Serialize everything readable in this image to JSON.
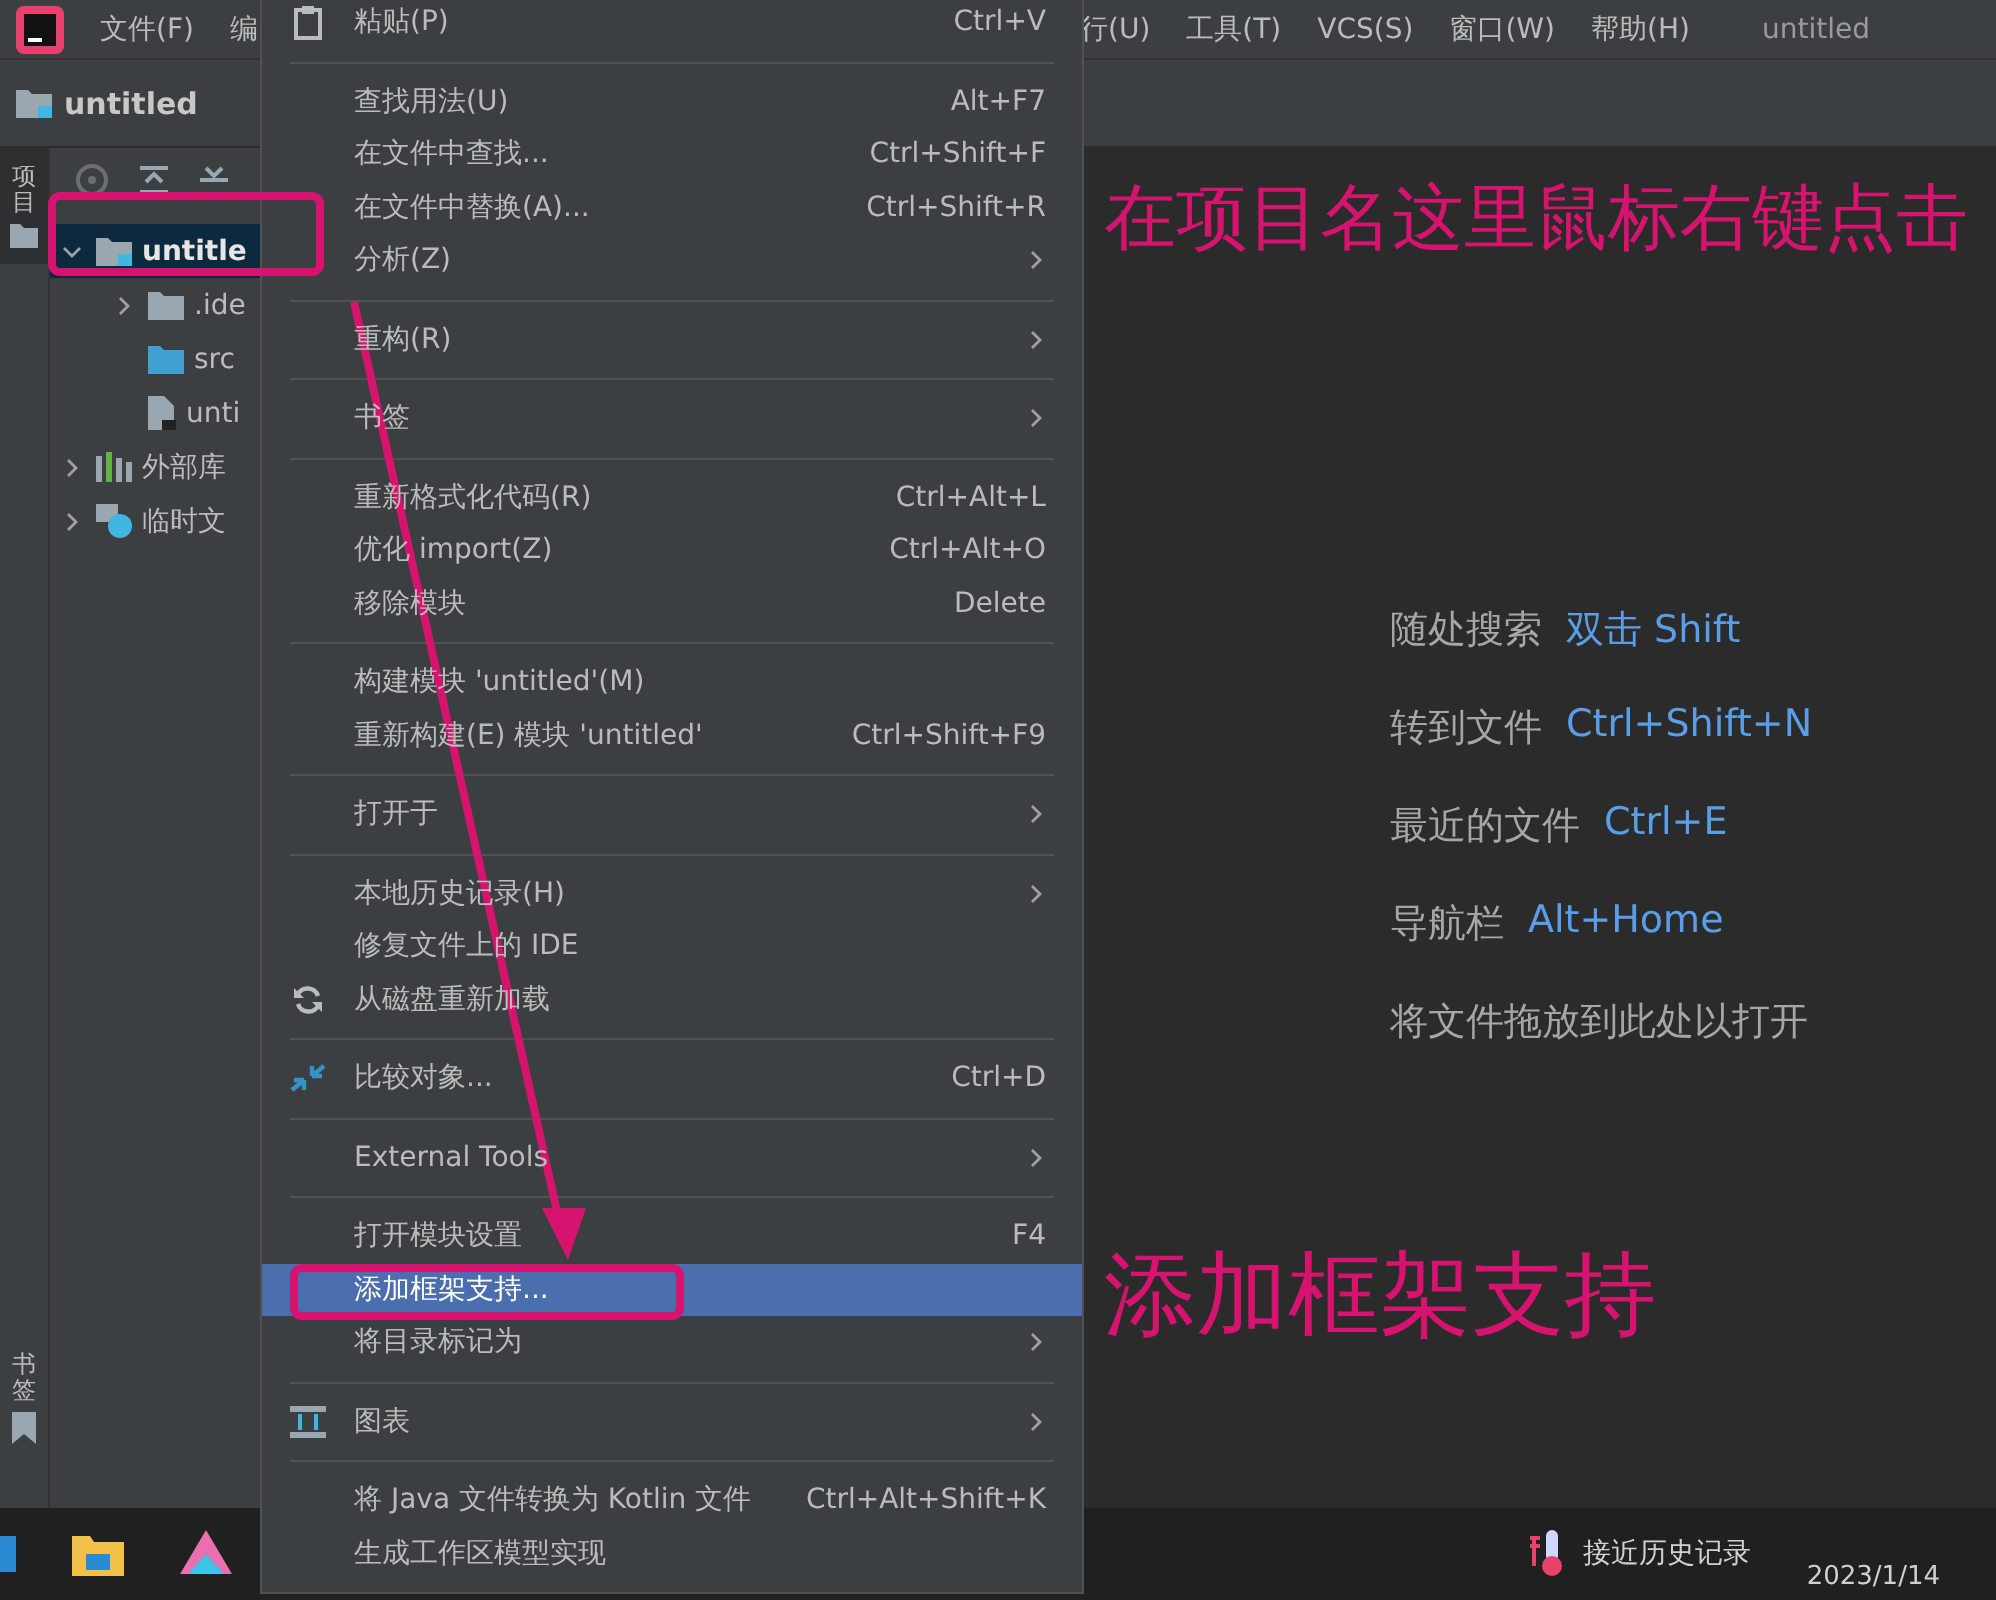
{
  "menu_bar": {
    "items": [
      {
        "label": "文件(F)"
      },
      {
        "label": "编"
      }
    ],
    "right_items": [
      {
        "label": "行(U)"
      },
      {
        "label": "工具(T)"
      },
      {
        "label": "VCS(S)"
      },
      {
        "label": "窗口(W)"
      },
      {
        "label": "帮助(H)"
      }
    ],
    "title": "untitled"
  },
  "nav_bar": {
    "project": "untitled"
  },
  "tool_strip": {
    "top": [
      {
        "label": "项目",
        "selected": true
      }
    ],
    "bottom": [
      {
        "label": "书签",
        "selected": false
      }
    ]
  },
  "project_tree": [
    {
      "label": "untitle",
      "kind": "module",
      "expanded": true,
      "selected": true,
      "children": [
        {
          "label": ".ide",
          "kind": "folder",
          "expanded": false,
          "selected": false
        },
        {
          "label": "src",
          "kind": "source",
          "selected": false
        },
        {
          "label": "unti",
          "kind": "file",
          "selected": false
        }
      ]
    },
    {
      "label": "外部库",
      "kind": "library",
      "expanded": false,
      "selected": false
    },
    {
      "label": "临时文",
      "kind": "scratch",
      "expanded": false,
      "selected": false
    }
  ],
  "context_menu": {
    "groups": [
      [
        {
          "label": "粘贴(P)",
          "shortcut": "Ctrl+V",
          "submenu": false,
          "selected": false,
          "kind": "paste"
        }
      ],
      [
        {
          "label": "查找用法(U)",
          "shortcut": "Alt+F7",
          "submenu": false,
          "selected": false,
          "kind": "plain"
        },
        {
          "label": "在文件中查找...",
          "shortcut": "Ctrl+Shift+F",
          "submenu": false,
          "selected": false,
          "kind": "plain"
        },
        {
          "label": "在文件中替换(A)...",
          "shortcut": "Ctrl+Shift+R",
          "submenu": false,
          "selected": false,
          "kind": "plain"
        },
        {
          "label": "分析(Z)",
          "submenu": true,
          "selected": false,
          "kind": "plain"
        }
      ],
      [
        {
          "label": "重构(R)",
          "submenu": true,
          "selected": false,
          "kind": "plain"
        }
      ],
      [
        {
          "label": "书签",
          "submenu": true,
          "selected": false,
          "kind": "plain"
        }
      ],
      [
        {
          "label": "重新格式化代码(R)",
          "shortcut": "Ctrl+Alt+L",
          "submenu": false,
          "selected": false,
          "kind": "plain"
        },
        {
          "label": "优化 import(Z)",
          "shortcut": "Ctrl+Alt+O",
          "submenu": false,
          "selected": false,
          "kind": "plain"
        },
        {
          "label": "移除模块",
          "shortcut": "Delete",
          "submenu": false,
          "selected": false,
          "kind": "plain"
        }
      ],
      [
        {
          "label": "构建模块 'untitled'(M)",
          "submenu": false,
          "selected": false,
          "kind": "plain"
        },
        {
          "label": "重新构建(E) 模块 'untitled'",
          "shortcut": "Ctrl+Shift+F9",
          "submenu": false,
          "selected": false,
          "kind": "plain"
        }
      ],
      [
        {
          "label": "打开于",
          "submenu": true,
          "selected": false,
          "kind": "plain"
        }
      ],
      [
        {
          "label": "本地历史记录(H)",
          "submenu": true,
          "selected": false,
          "kind": "plain"
        },
        {
          "label": "修复文件上的 IDE",
          "submenu": false,
          "selected": false,
          "kind": "plain"
        },
        {
          "label": "从磁盘重新加载",
          "submenu": false,
          "selected": false,
          "kind": "reload"
        }
      ],
      [
        {
          "label": "比较对象...",
          "shortcut": "Ctrl+D",
          "submenu": false,
          "selected": false,
          "kind": "compare"
        }
      ],
      [
        {
          "label": "External Tools",
          "submenu": true,
          "selected": false,
          "kind": "plain"
        }
      ],
      [
        {
          "label": "打开模块设置",
          "shortcut": "F4",
          "submenu": false,
          "selected": false,
          "kind": "plain"
        },
        {
          "label": "添加框架支持...",
          "submenu": false,
          "selected": true,
          "kind": "plain"
        },
        {
          "label": "将目录标记为",
          "submenu": true,
          "selected": false,
          "kind": "plain"
        }
      ],
      [
        {
          "label": "图表",
          "submenu": true,
          "selected": false,
          "kind": "diagram"
        }
      ],
      [
        {
          "label": "将 Java 文件转换为 Kotlin 文件",
          "shortcut": "Ctrl+Alt+Shift+K",
          "submenu": false,
          "selected": false,
          "kind": "plain"
        },
        {
          "label": "生成工作区模型实现",
          "submenu": false,
          "selected": false,
          "kind": "plain"
        }
      ]
    ]
  },
  "welcome": [
    {
      "label": "随处搜索",
      "shortcut": "双击 Shift"
    },
    {
      "label": "转到文件",
      "shortcut": "Ctrl+Shift+N"
    },
    {
      "label": "最近的文件",
      "shortcut": "Ctrl+E"
    },
    {
      "label": "导航栏",
      "shortcut": "Alt+Home"
    },
    {
      "label": "将文件拖放到此处以打开"
    }
  ],
  "annotations": [
    {
      "text": "在项目名这里鼠标右键点击"
    },
    {
      "text": "添加框架支持"
    }
  ],
  "taskbar": {
    "status_text": "接近历史记录",
    "date": "2023/1/14"
  }
}
